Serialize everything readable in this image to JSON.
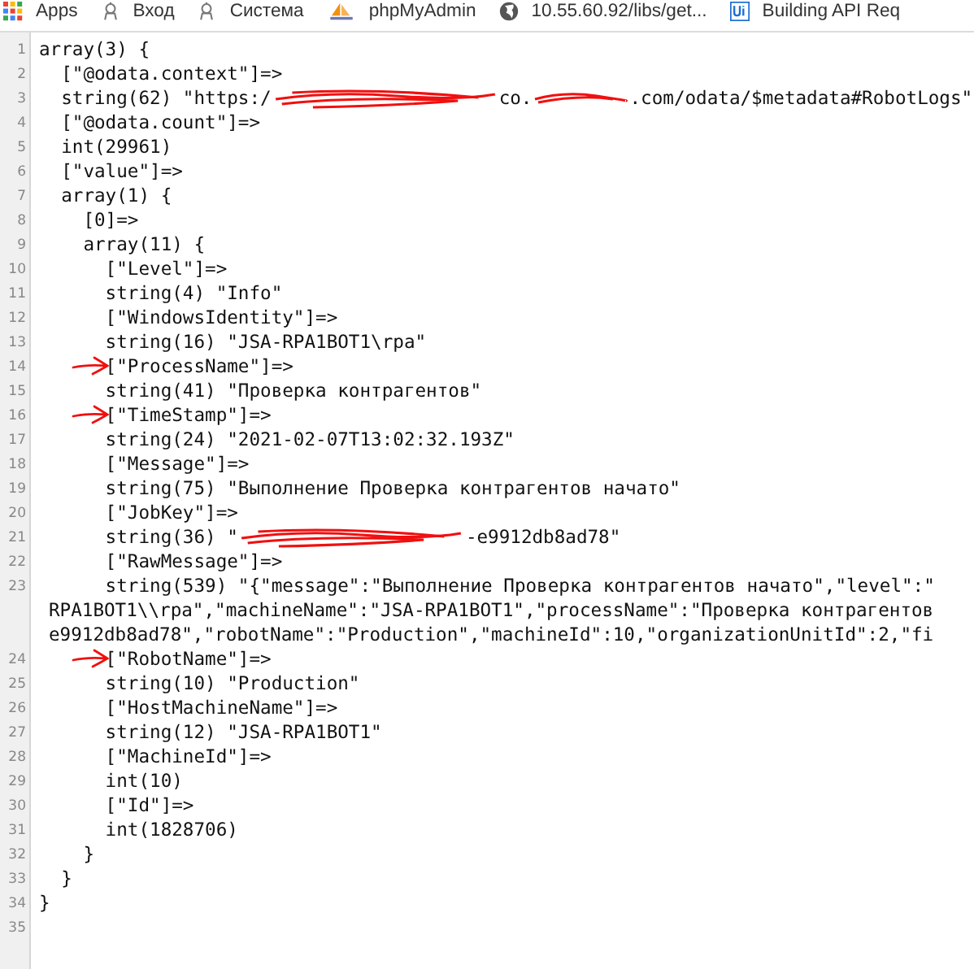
{
  "bookmarks": [
    {
      "kind": "apps",
      "label": "Apps"
    },
    {
      "kind": "robot",
      "label": "Вход"
    },
    {
      "kind": "robot",
      "label": "Система"
    },
    {
      "kind": "pma",
      "label": "phpMyAdmin"
    },
    {
      "kind": "globe",
      "label": "10.55.60.92/libs/get..."
    },
    {
      "kind": "ui",
      "label": "Building API Req"
    }
  ],
  "lines": [
    {
      "number": "1",
      "arrow": false,
      "text": "array(3) {"
    },
    {
      "number": "2",
      "arrow": false,
      "text": "  [\"@odata.context\"]=>"
    },
    {
      "number": "3",
      "arrow": false,
      "segments": [
        {
          "kind": "text",
          "text": "  string(62) \"https:/"
        },
        {
          "kind": "long-scribble"
        },
        {
          "kind": "text",
          "text": "co."
        },
        {
          "kind": "short-scribble"
        },
        {
          "kind": "text",
          "text": ".com/odata/$metadata#RobotLogs\""
        }
      ]
    },
    {
      "number": "4",
      "arrow": false,
      "text": "  [\"@odata.count\"]=>"
    },
    {
      "number": "5",
      "arrow": false,
      "text": "  int(29961)"
    },
    {
      "number": "6",
      "arrow": false,
      "text": "  [\"value\"]=>"
    },
    {
      "number": "7",
      "arrow": false,
      "text": "  array(1) {"
    },
    {
      "number": "8",
      "arrow": false,
      "text": "    [0]=>"
    },
    {
      "number": "9",
      "arrow": false,
      "text": "    array(11) {"
    },
    {
      "number": "10",
      "arrow": false,
      "text": "      [\"Level\"]=>"
    },
    {
      "number": "11",
      "arrow": false,
      "text": "      string(4) \"Info\""
    },
    {
      "number": "12",
      "arrow": false,
      "text": "      [\"WindowsIdentity\"]=>"
    },
    {
      "number": "13",
      "arrow": false,
      "text": "      string(16) \"JSA-RPA1BOT1\\rpa\""
    },
    {
      "number": "14",
      "arrow": true,
      "text": "      [\"ProcessName\"]=>"
    },
    {
      "number": "15",
      "arrow": false,
      "text": "      string(41) \"Проверка контрагентов\""
    },
    {
      "number": "16",
      "arrow": true,
      "text": "      [\"TimeStamp\"]=>"
    },
    {
      "number": "17",
      "arrow": false,
      "text": "      string(24) \"2021-02-07T13:02:32.193Z\""
    },
    {
      "number": "18",
      "arrow": false,
      "text": "      [\"Message\"]=>"
    },
    {
      "number": "19",
      "arrow": false,
      "text": "      string(75) \"Выполнение Проверка контрагентов начато\""
    },
    {
      "number": "20",
      "arrow": false,
      "text": "      [\"JobKey\"]=>"
    },
    {
      "number": "21",
      "arrow": false,
      "segments": [
        {
          "kind": "text",
          "text": "      string(36) \""
        },
        {
          "kind": "long-scribble"
        },
        {
          "kind": "text",
          "text": "-e9912db8ad78\""
        }
      ]
    },
    {
      "number": "22",
      "arrow": false,
      "text": "      [\"RawMessage\"]=>"
    },
    {
      "number": "23",
      "arrow": false,
      "text": "      string(539) \"{\"message\":\"Выполнение Проверка контрагентов начато\",\"level\":\"",
      "continuation": [
        "RPA1BOT1\\\\rpa\",\"machineName\":\"JSA-RPA1BOT1\",\"processName\":\"Проверка контрагентов",
        "e9912db8ad78\",\"robotName\":\"Production\",\"machineId\":10,\"organizationUnitId\":2,\"fi"
      ]
    },
    {
      "number": "24",
      "arrow": true,
      "text": "      [\"RobotName\"]=>"
    },
    {
      "number": "25",
      "arrow": false,
      "text": "      string(10) \"Production\""
    },
    {
      "number": "26",
      "arrow": false,
      "text": "      [\"HostMachineName\"]=>"
    },
    {
      "number": "27",
      "arrow": false,
      "text": "      string(12) \"JSA-RPA1BOT1\""
    },
    {
      "number": "28",
      "arrow": false,
      "text": "      [\"MachineId\"]=>"
    },
    {
      "number": "29",
      "arrow": false,
      "text": "      int(10)"
    },
    {
      "number": "30",
      "arrow": false,
      "text": "      [\"Id\"]=>"
    },
    {
      "number": "31",
      "arrow": false,
      "text": "      int(1828706)"
    },
    {
      "number": "32",
      "arrow": false,
      "text": "    }"
    },
    {
      "number": "33",
      "arrow": false,
      "text": "  }"
    },
    {
      "number": "34",
      "arrow": false,
      "text": "}"
    },
    {
      "number": "35",
      "arrow": false
    }
  ]
}
